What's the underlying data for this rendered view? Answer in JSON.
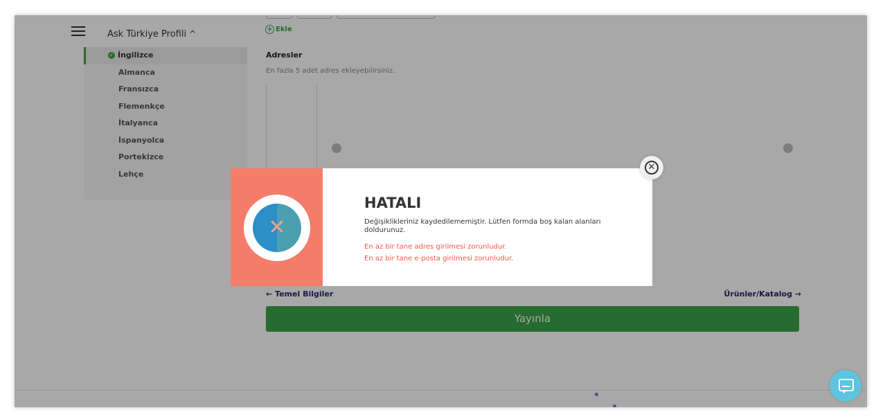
{
  "sidebar": {
    "profile_title": "Ask Türkiye Profili",
    "languages": [
      "İngilizce",
      "Almanca",
      "Fransızca",
      "Flemenkçe",
      "İtalyanca",
      "İspanyolca",
      "Portekizce",
      "Lehçe"
    ],
    "active_index": 0
  },
  "form": {
    "add_label": "Ekle",
    "addresses_title": "Adresler",
    "addresses_hint": "En fazla 5 adet adres ekleyebilirsiniz."
  },
  "navigation": {
    "prev_label": "← Temel Bilgiler",
    "next_label": "Ürünler/Katalog →",
    "publish_label": "Yayınla"
  },
  "modal": {
    "title": "HATALI",
    "message": "Değişiklikleriniz kaydedilememiştir. Lütfen formda boş kalan alanları doldurunuz.",
    "errors": [
      "En az bir tane adres girilmesi zorunludur.",
      "En az bir tane e-posta girilmesi zorunludur."
    ]
  },
  "icons": {
    "menu": "hamburger-menu-icon",
    "chevron": "chevron-up-icon",
    "check": "check-circle-icon",
    "add": "plus-circle-icon",
    "error": "x-circle-icon",
    "close": "close-circle-icon",
    "chat": "chat-icon"
  },
  "colors": {
    "accent_green": "#3ba34a",
    "error_red": "#f05a4a",
    "modal_left_bg": "#f47c6b",
    "nav_link": "#1f2a6b",
    "chat_bubble": "#5ec4e0"
  }
}
